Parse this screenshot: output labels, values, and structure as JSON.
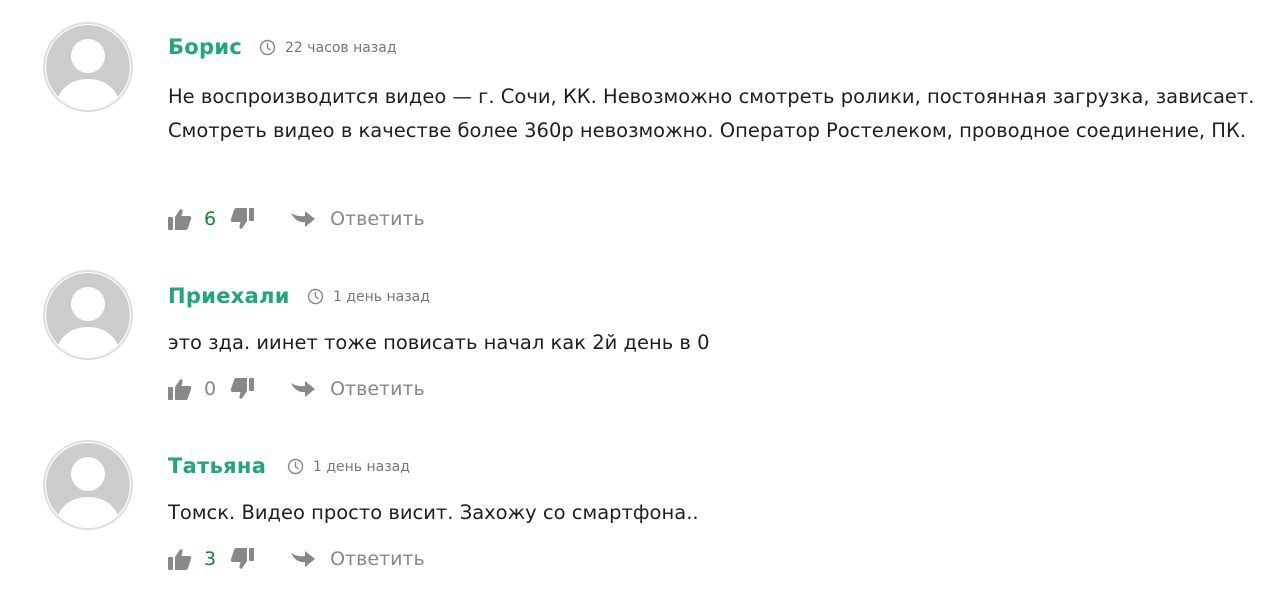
{
  "comments": [
    {
      "author": "Борис",
      "time": "22 часов назад",
      "text": "Не воспроизводится видео — г. Сочи, КК. Невозможно смотреть ролики, постоянная загрузка, зависает. Смотреть видео в качестве более 360р невозможно. Оператор Ростелеком, проводное соединение, ПК.",
      "likes": "6",
      "reply_label": "Ответить"
    },
    {
      "author": "Приехали",
      "time": "1 день назад",
      "text": "это зда. иинет тоже повисать начал как 2й день в 0",
      "likes": "0",
      "reply_label": "Ответить"
    },
    {
      "author": "Татьяна",
      "time": "1 день назад",
      "text": "Томск. Видео просто висит. Захожу со смартфона..",
      "likes": "3",
      "reply_label": "Ответить"
    }
  ],
  "colors": {
    "author": "#1fa67a",
    "likes_positive": "#118a2f",
    "muted": "#888888",
    "avatar_fill": "#cccccc"
  },
  "icons": {
    "avatar": "user-avatar-icon",
    "time": "clock-icon",
    "like": "thumbs-up-icon",
    "dislike": "thumbs-down-icon",
    "reply": "reply-arrow-icon"
  }
}
